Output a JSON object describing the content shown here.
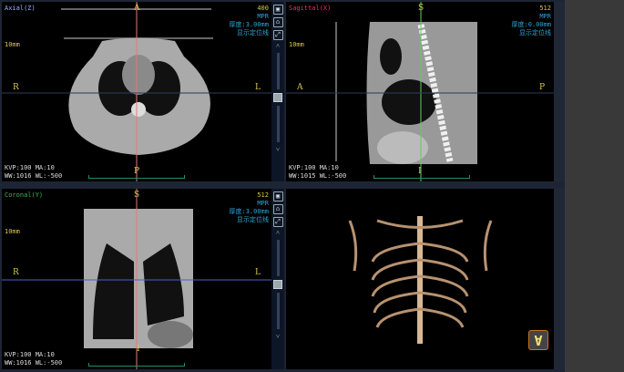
{
  "axial": {
    "title": "Axial(Z)",
    "top": "A",
    "bottom": "P",
    "left": "R",
    "right": "L",
    "slice": "400",
    "mode": "MPR",
    "thickness": "厚度:3.00mm",
    "locator": "显示定位线",
    "scale": "10mm",
    "kvp": "KVP:100 MA:10",
    "window": "WW:1016  WL:-500"
  },
  "sagittal": {
    "title": "Sagittal(X)",
    "top": "S",
    "bottom": "I",
    "left": "A",
    "right": "P",
    "slice": "512",
    "mode": "MPR",
    "thickness": "厚度:0.00mm",
    "locator": "显示定位线",
    "scale": "10mm",
    "kvp": "KVP:100 MA:10",
    "window": "WW:1015  WL:-500"
  },
  "coronal": {
    "title": "Coronal(Y)",
    "top": "S",
    "bottom": "I",
    "left": "R",
    "right": "L",
    "slice": "512",
    "mode": "MPR",
    "thickness": "厚度:3.00mm",
    "locator": "显示定位线",
    "scale": "10mm",
    "kvp": "KVP:100 MA:10",
    "window": "WW:1016  WL:-500"
  },
  "volume": {
    "orientation_button": "A"
  },
  "colors": {
    "crosshair_v": "#e07a7a",
    "crosshair_h": "#4a5fd0",
    "accent": "#2aa6d8"
  }
}
